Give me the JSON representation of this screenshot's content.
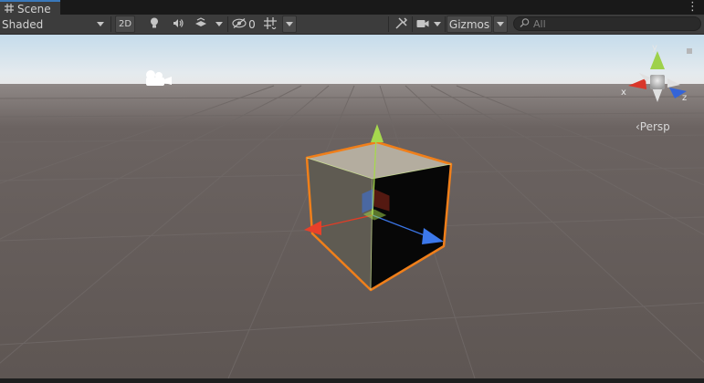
{
  "window": {
    "tab_label": "Scene",
    "tab_icon": "grid-icon",
    "menu_icon": "kebab-menu-icon"
  },
  "toolbar": {
    "shading_mode": "Shaded",
    "two_d_label": "2D",
    "hidden_count": "0",
    "gizmos_label": "Gizmos",
    "search_placeholder": "All",
    "icons": [
      "lightbulb-icon",
      "audio-icon",
      "effects-icon",
      "visibility-icon",
      "grid-snap-icon",
      "tools-icon",
      "camera-icon",
      "search-icon"
    ]
  },
  "scene": {
    "projection_label": "‹Persp",
    "axis_labels": {
      "x": "x",
      "y": "y",
      "z": "z"
    },
    "colors": {
      "sky_top": "#c5dceb",
      "horizon": "#e7e9ea",
      "ground": "#5e5653",
      "grid_line": "#6c6563",
      "selection_outline": "#f07f1a",
      "axis_x": "#e43c25",
      "axis_y": "#9ed14a",
      "axis_z": "#3a74e4",
      "cube_top": "#b4ad9f",
      "cube_front": "#5f5b52",
      "cube_side": "#060606"
    }
  }
}
